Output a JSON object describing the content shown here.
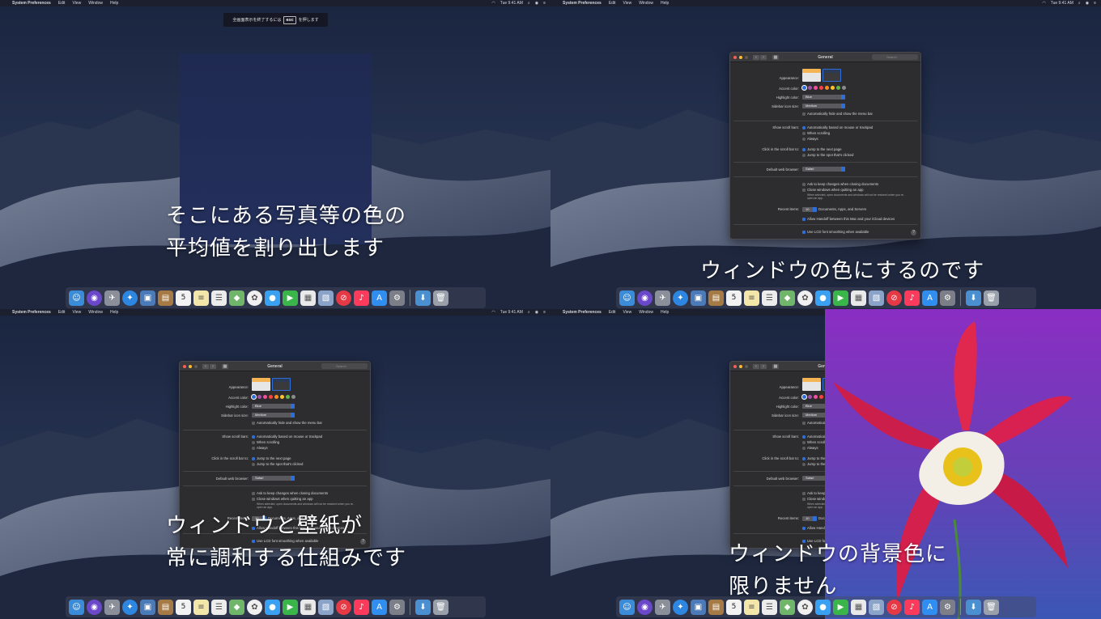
{
  "menubar": {
    "app_name": "System Preferences",
    "menus": [
      "Edit",
      "View",
      "Window",
      "Help"
    ],
    "clock": "Tue 9:41 AM"
  },
  "esc_hint": {
    "before": "全画面表示を終了するには",
    "key": "esc",
    "after": "を押します"
  },
  "captions": {
    "panel1": [
      "そこにある写真等の色の",
      "平均値を割り出します"
    ],
    "panel2": [
      "ウィンドウの色にするのです"
    ],
    "panel3": [
      "ウィンドウと壁紙が",
      "常に調和する仕組みです"
    ],
    "panel4": [
      "ウィンドウの背景色に",
      "限りません"
    ]
  },
  "prefs": {
    "title": "General",
    "search_placeholder": "Search",
    "appearance_label": "Appearance:",
    "accent_label": "Accent color:",
    "accent_colors": [
      "#2f6dd8",
      "#a550a7",
      "#f74f9e",
      "#f74342",
      "#fd8d22",
      "#fdc62c",
      "#62ba46",
      "#8c8c8c"
    ],
    "highlight_label": "Highlight color:",
    "highlight_value": "Blue",
    "sidebar_label": "Sidebar icon size:",
    "sidebar_value": "Medium",
    "autohide_menu": "Automatically hide and show the menu bar",
    "scroll_label": "Show scroll bars:",
    "scroll_options": [
      "Automatically based on mouse or trackpad",
      "When scrolling",
      "Always"
    ],
    "click_label": "Click in the scroll bar to:",
    "click_options": [
      "Jump to the next page",
      "Jump to the spot that's clicked"
    ],
    "browser_label": "Default web browser:",
    "browser_value": "Safari",
    "ask_keep": "Ask to keep changes when closing documents",
    "close_windows": "Close windows when quitting an app",
    "close_note": "When selected, open documents and windows will not be restored when you re-open an app.",
    "recent_label": "Recent items:",
    "recent_value": "10",
    "recent_suffix": "Documents, Apps, and Servers",
    "handoff": "Allow Handoff between this Mac and your iCloud devices",
    "lcd": "Use LCD font smoothing when available",
    "help": "?"
  },
  "dock": {
    "icons": [
      "finder-icon",
      "siri-icon",
      "launchpad-icon",
      "safari-icon",
      "photo-slideshow-icon",
      "notes-book-icon",
      "calendar-icon",
      "stickies-icon",
      "reminders-icon",
      "maps-icon",
      "photos-icon",
      "messages-icon",
      "facetime-icon",
      "news-icon",
      "preview-icon",
      "news-stop-icon",
      "music-icon",
      "app-store-icon",
      "system-preferences-icon",
      "downloads-folder-icon",
      "trash-icon"
    ],
    "calendar_day": "5"
  }
}
